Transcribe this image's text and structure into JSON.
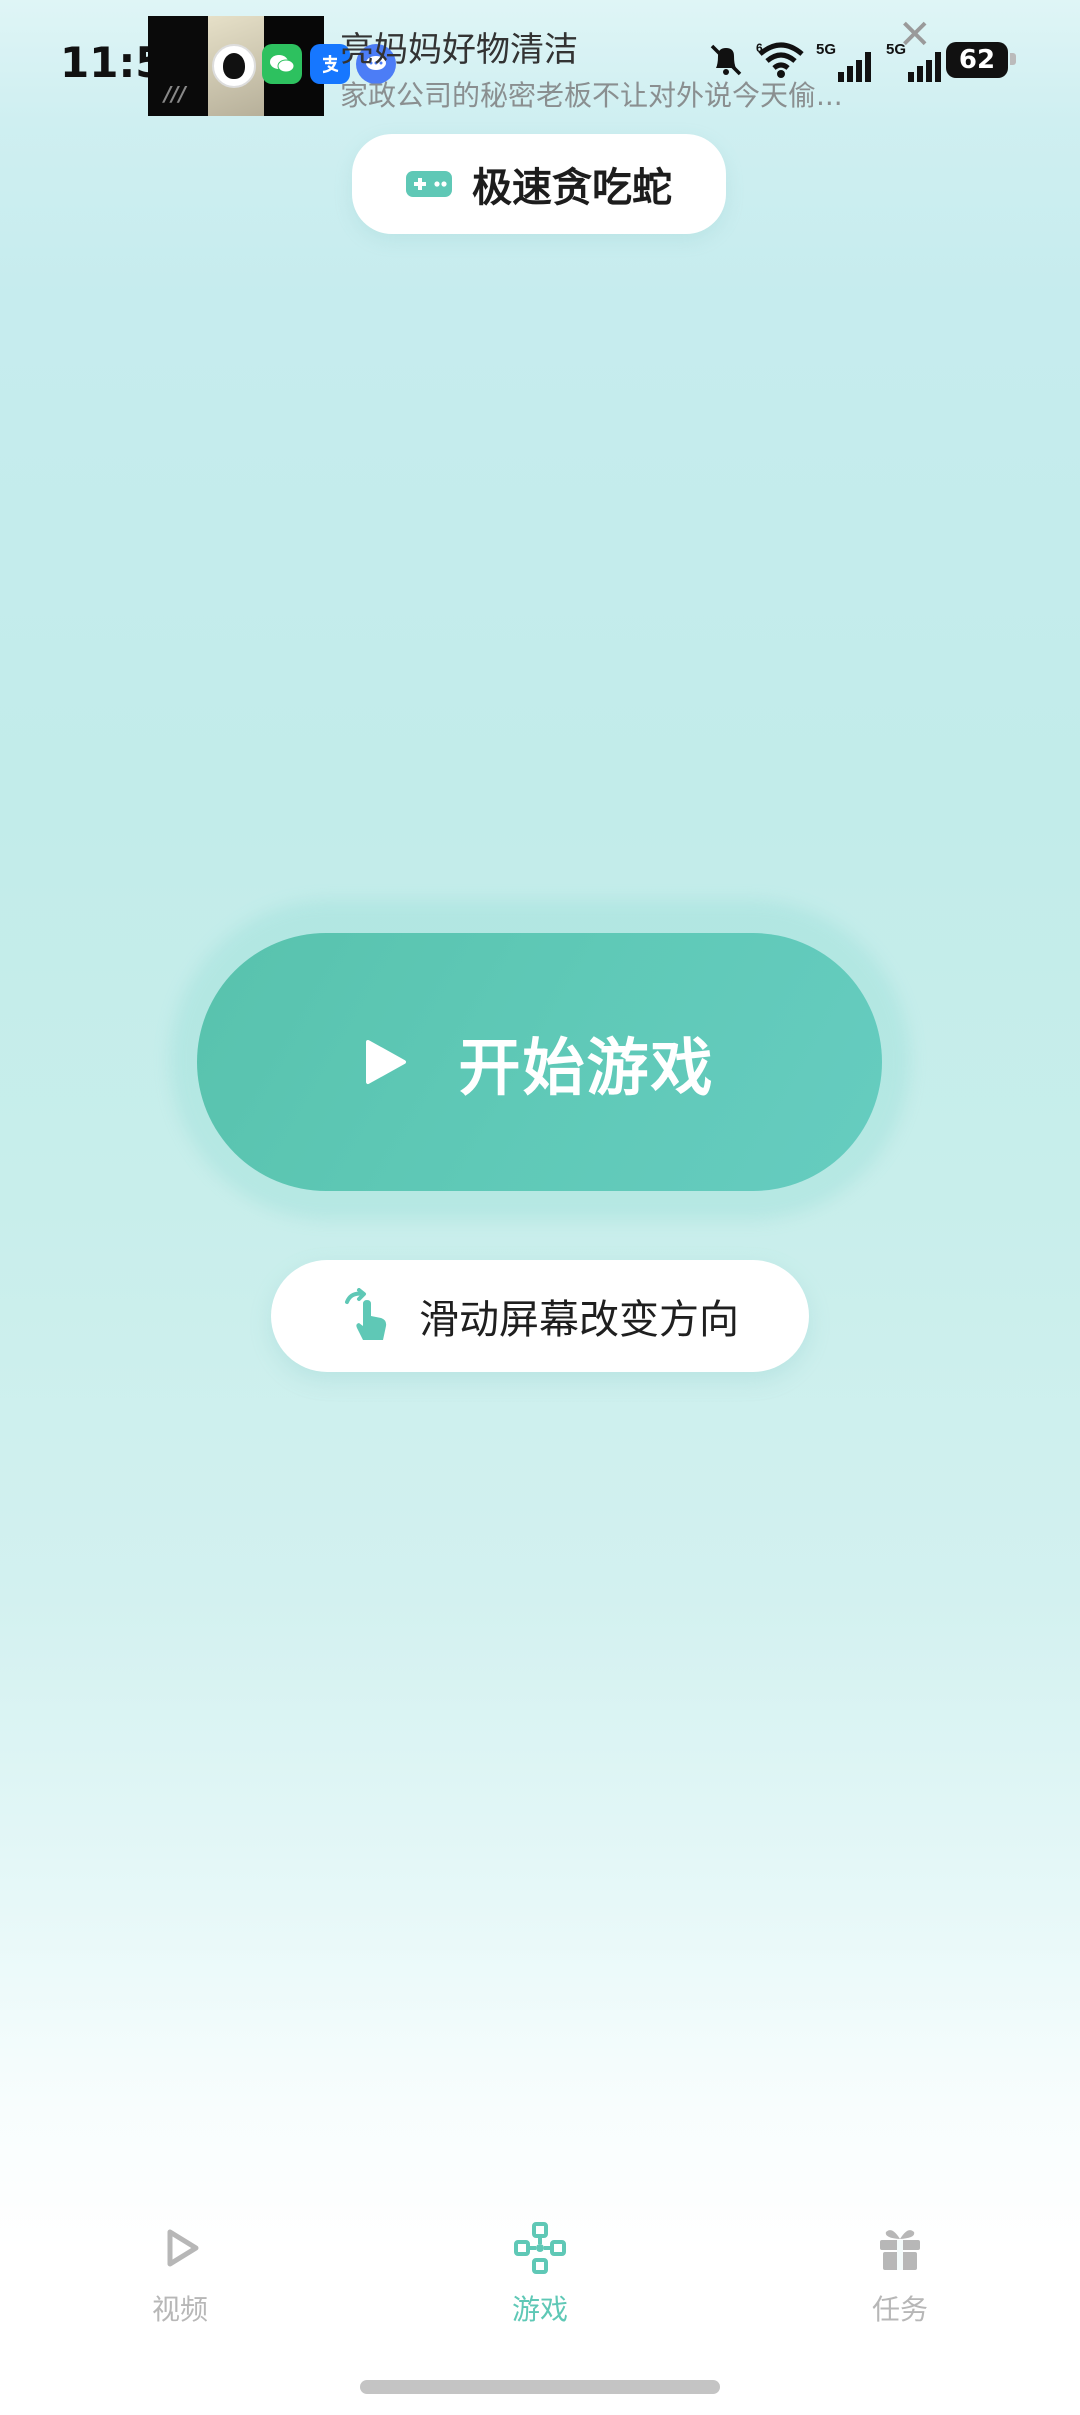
{
  "status_bar": {
    "time": "11:54",
    "battery": "62",
    "network_labels": [
      "5G",
      "5G"
    ]
  },
  "notification": {
    "title": "亮妈妈好物清洁",
    "body": "家政公司的秘密老板不让对外说今天偷..."
  },
  "header": {
    "title": "极速贪吃蛇",
    "icon": "gamepad-icon"
  },
  "main": {
    "start_label": "开始游戏",
    "hint_label": "滑动屏幕改变方向"
  },
  "bottom_nav": {
    "items": [
      {
        "label": "视频",
        "icon": "play-outline-icon",
        "active": false
      },
      {
        "label": "游戏",
        "icon": "gamepad-icon",
        "active": true
      },
      {
        "label": "任务",
        "icon": "gift-icon",
        "active": false
      }
    ]
  },
  "colors": {
    "accent": "#5fc8b6",
    "button": "#5fc5b3",
    "inactive": "#b7b7b7"
  }
}
